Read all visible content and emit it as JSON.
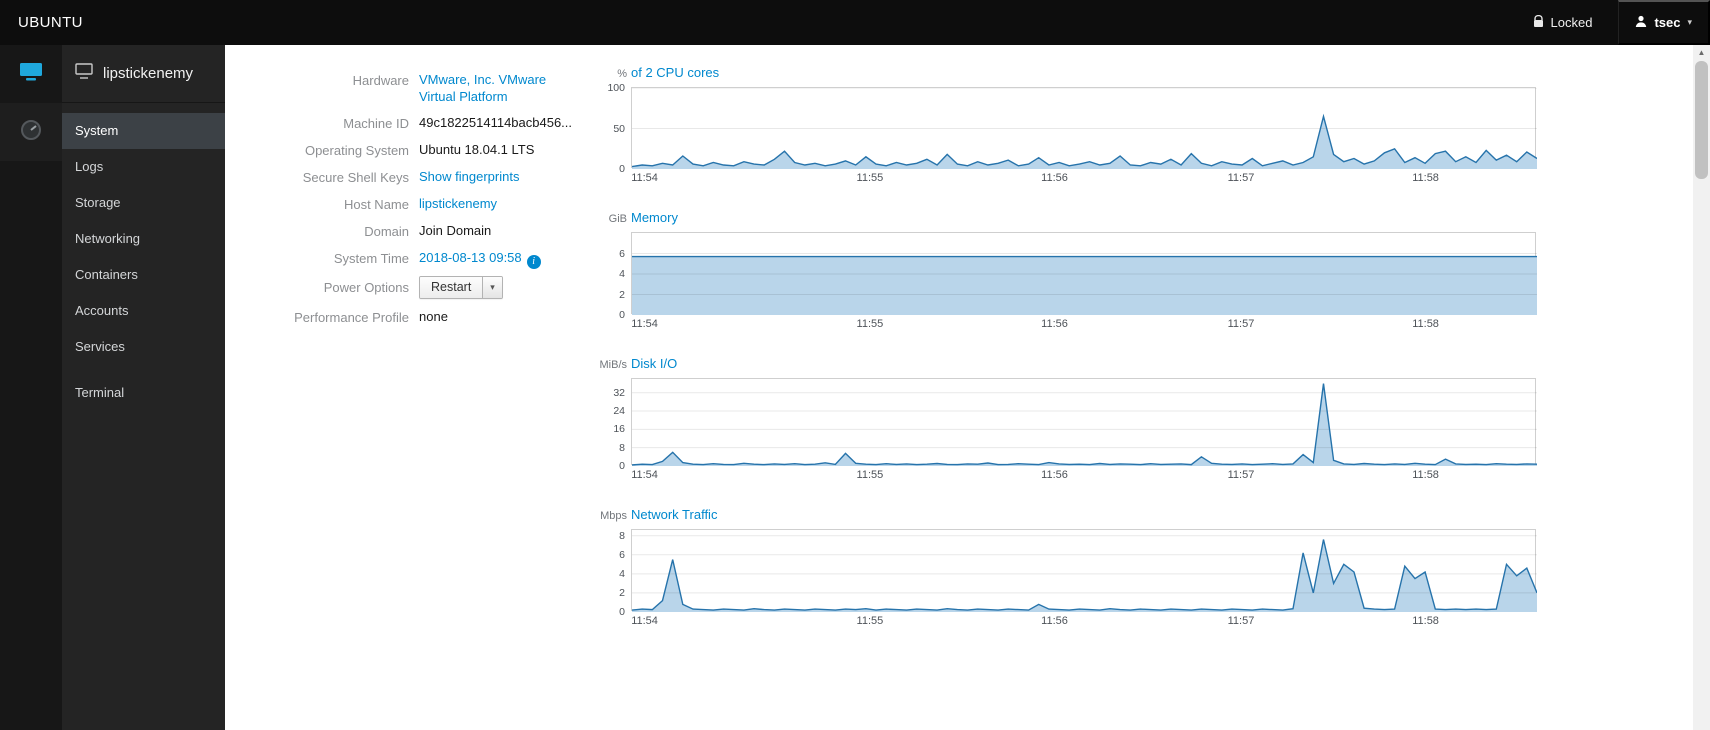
{
  "topbar": {
    "brand": "UBUNTU",
    "locked_label": "Locked",
    "user_label": "tsec"
  },
  "sidebar": {
    "host_name": "lipstickenemy",
    "items": [
      "System",
      "Logs",
      "Storage",
      "Networking",
      "Containers",
      "Accounts",
      "Services"
    ],
    "terminal_label": "Terminal"
  },
  "info": {
    "rows": [
      {
        "label": "Hardware",
        "value": "VMware, Inc. VMware Virtual Platform"
      },
      {
        "label": "Machine ID",
        "value": "49c1822514114bacb456..."
      },
      {
        "label": "Operating System",
        "value": "Ubuntu 18.04.1 LTS"
      },
      {
        "label": "Secure Shell Keys",
        "value": "Show fingerprints"
      },
      {
        "label": "Host Name",
        "value": "lipstickenemy"
      },
      {
        "label": "Domain",
        "value": "Join Domain"
      },
      {
        "label": "System Time",
        "value": "2018-08-13 09:58"
      },
      {
        "label": "Power Options",
        "value": "Restart"
      },
      {
        "label": "Performance Profile",
        "value": "none"
      }
    ]
  },
  "icons": {
    "caret": "▾",
    "info_glyph": "i",
    "scroll_up": "▲"
  },
  "colors": {
    "accent": "#0088ce",
    "chart_line": "#2673ab",
    "chart_fill": "#b9d5ea",
    "grid": "rgba(0,0,0,0.09)"
  },
  "chart_data": [
    {
      "type": "area",
      "title": "of 2 CPU cores",
      "unit": "%",
      "y_ticks": [
        0,
        50,
        100
      ],
      "y_max": 100,
      "height": 81,
      "x_ticks": [
        "11:54",
        "11:55",
        "11:56",
        "11:57",
        "11:58"
      ],
      "x_tick_fractions": [
        0.015,
        0.264,
        0.468,
        0.674,
        0.878
      ],
      "values": [
        3,
        5,
        4,
        7,
        5,
        16,
        6,
        4,
        8,
        5,
        4,
        9,
        6,
        5,
        12,
        22,
        8,
        5,
        7,
        4,
        6,
        10,
        5,
        15,
        6,
        4,
        8,
        5,
        7,
        12,
        5,
        18,
        6,
        4,
        9,
        5,
        7,
        11,
        4,
        6,
        14,
        5,
        8,
        4,
        6,
        9,
        5,
        7,
        16,
        5,
        4,
        8,
        6,
        12,
        5,
        19,
        7,
        4,
        9,
        6,
        5,
        13,
        4,
        7,
        10,
        5,
        8,
        15,
        65,
        18,
        9,
        13,
        6,
        10,
        20,
        25,
        8,
        14,
        7,
        19,
        22,
        9,
        15,
        8,
        23,
        11,
        17,
        9,
        21,
        13
      ]
    },
    {
      "type": "area",
      "title": "Memory",
      "unit": "GiB",
      "y_ticks": [
        0,
        2,
        4,
        6
      ],
      "y_max": 8,
      "height": 82,
      "x_ticks": [
        "11:54",
        "11:55",
        "11:56",
        "11:57",
        "11:58"
      ],
      "x_tick_fractions": [
        0.015,
        0.264,
        0.468,
        0.674,
        0.878
      ],
      "values": [
        5.7,
        5.7,
        5.7,
        5.7,
        5.7,
        5.7,
        5.7,
        5.7,
        5.7,
        5.7,
        5.7,
        5.7
      ]
    },
    {
      "type": "area",
      "title": "Disk I/O",
      "unit": "MiB/s",
      "y_ticks": [
        0,
        8,
        16,
        24,
        32
      ],
      "y_max": 38,
      "height": 87,
      "x_ticks": [
        "11:54",
        "11:55",
        "11:56",
        "11:57",
        "11:58"
      ],
      "x_tick_fractions": [
        0.015,
        0.264,
        0.468,
        0.674,
        0.878
      ],
      "values": [
        0.5,
        0.8,
        0.6,
        2,
        6,
        1.5,
        0.8,
        0.6,
        1,
        0.7,
        0.6,
        1.2,
        0.8,
        0.6,
        0.9,
        0.7,
        1,
        0.6,
        0.8,
        1.4,
        0.7,
        5.5,
        1.2,
        0.8,
        0.6,
        1,
        0.7,
        0.9,
        0.6,
        0.8,
        1.1,
        0.7,
        0.6,
        0.9,
        0.8,
        1.3,
        0.6,
        0.7,
        1,
        0.8,
        0.6,
        1.5,
        0.9,
        0.7,
        0.8,
        0.6,
        1.1,
        0.7,
        0.9,
        0.8,
        0.6,
        1,
        0.7,
        0.8,
        0.9,
        0.6,
        4,
        1.2,
        0.8,
        0.7,
        0.9,
        0.6,
        0.8,
        1,
        0.7,
        0.9,
        5,
        1.5,
        36,
        2.5,
        0.9,
        0.7,
        1.1,
        0.8,
        0.6,
        0.9,
        0.7,
        1.2,
        0.8,
        0.6,
        3,
        0.9,
        0.7,
        0.8,
        0.6,
        1,
        0.8,
        0.7,
        0.9,
        0.8
      ]
    },
    {
      "type": "area",
      "title": "Network Traffic",
      "unit": "Mbps",
      "y_ticks": [
        0,
        2,
        4,
        6,
        8
      ],
      "y_max": 8.6,
      "height": 82,
      "x_ticks": [
        "11:54",
        "11:55",
        "11:56",
        "11:57",
        "11:58"
      ],
      "x_tick_fractions": [
        0.015,
        0.264,
        0.468,
        0.674,
        0.878
      ],
      "values": [
        0.2,
        0.3,
        0.25,
        1.2,
        5.5,
        0.8,
        0.3,
        0.25,
        0.2,
        0.3,
        0.25,
        0.2,
        0.35,
        0.25,
        0.2,
        0.3,
        0.25,
        0.2,
        0.3,
        0.25,
        0.2,
        0.3,
        0.25,
        0.35,
        0.2,
        0.3,
        0.25,
        0.2,
        0.3,
        0.25,
        0.2,
        0.35,
        0.25,
        0.2,
        0.3,
        0.25,
        0.2,
        0.3,
        0.25,
        0.2,
        0.8,
        0.3,
        0.25,
        0.2,
        0.3,
        0.25,
        0.2,
        0.35,
        0.25,
        0.2,
        0.3,
        0.25,
        0.2,
        0.3,
        0.25,
        0.2,
        0.3,
        0.25,
        0.2,
        0.3,
        0.25,
        0.2,
        0.3,
        0.25,
        0.2,
        0.35,
        6.2,
        2,
        7.6,
        3,
        5,
        4.2,
        0.4,
        0.3,
        0.25,
        0.3,
        4.8,
        3.5,
        4.2,
        0.3,
        0.25,
        0.3,
        0.25,
        0.3,
        0.25,
        0.3,
        5,
        3.8,
        4.6,
        2
      ]
    }
  ]
}
